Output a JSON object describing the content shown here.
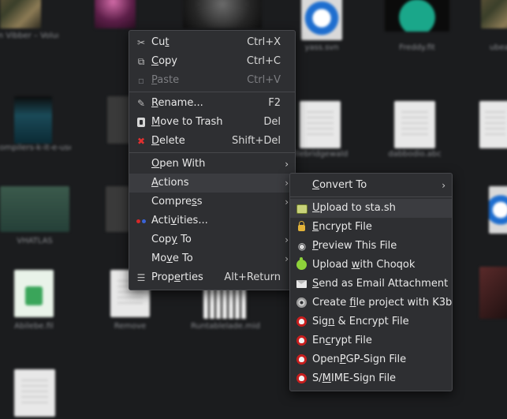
{
  "desktop": {
    "files": [
      {
        "label": "Brion Vibber – Volumic",
        "thumb": "photo1"
      },
      {
        "label": "",
        "thumb": "photo2"
      },
      {
        "label": "",
        "thumb": "photo3"
      },
      {
        "label": "yass.svn",
        "thumb": "globe"
      },
      {
        "label": "Freddy.fit",
        "thumb": "teal"
      },
      {
        "label": "ubeat...",
        "thumb": "photo1"
      },
      {
        "label": "compilers-k-it-e-user-manual.pdf",
        "thumb": "pdf"
      },
      {
        "label": "",
        "thumb": "dark"
      },
      {
        "label": "filebridgewald",
        "thumb": "doc"
      },
      {
        "label": "dabbodio.abc",
        "thumb": "doc"
      },
      {
        "label": "",
        "thumb": "doc"
      },
      {
        "label": "VHATLAS",
        "thumb": "sheet"
      },
      {
        "label": "",
        "thumb": "dark"
      },
      {
        "label": "",
        "thumb": "blue"
      },
      {
        "label": "Abilebe.fil",
        "thumb": "green"
      },
      {
        "label": "Remove",
        "thumb": "doc"
      },
      {
        "label": "Runtablelade.mid",
        "thumb": "keys"
      },
      {
        "label": "",
        "thumb": "red"
      },
      {
        "label": "",
        "thumb": "doc"
      }
    ]
  },
  "context_menu": {
    "items": [
      {
        "type": "item",
        "icon": "cut-icon",
        "glyph": "✂",
        "pre": "Cu",
        "mn": "t",
        "post": "",
        "shortcut": "Ctrl+X",
        "disabled": false,
        "submenu": false
      },
      {
        "type": "item",
        "icon": "copy-icon",
        "glyph": "⧉",
        "pre": "",
        "mn": "C",
        "post": "opy",
        "shortcut": "Ctrl+C",
        "disabled": false,
        "submenu": false
      },
      {
        "type": "item",
        "icon": "paste-icon",
        "glyph": "📋",
        "pre": "",
        "mn": "P",
        "post": "aste",
        "shortcut": "Ctrl+V",
        "disabled": true,
        "submenu": false
      },
      {
        "type": "separator"
      },
      {
        "type": "item",
        "icon": "rename-icon",
        "glyph": "✎",
        "pre": "",
        "mn": "R",
        "post": "ename...",
        "shortcut": "F2",
        "disabled": false,
        "submenu": false
      },
      {
        "type": "item",
        "icon": "trash-icon",
        "glyph": "",
        "pre": "",
        "mn": "M",
        "post": "ove to Trash",
        "shortcut": "Del",
        "disabled": false,
        "submenu": false
      },
      {
        "type": "item",
        "icon": "delete-icon",
        "glyph": "✖",
        "pre": "",
        "mn": "D",
        "post": "elete",
        "shortcut": "Shift+Del",
        "disabled": false,
        "submenu": false
      },
      {
        "type": "separator"
      },
      {
        "type": "item",
        "icon": "",
        "glyph": "",
        "pre": "",
        "mn": "O",
        "post": "pen With",
        "shortcut": "",
        "disabled": false,
        "submenu": true
      },
      {
        "type": "item",
        "icon": "",
        "glyph": "",
        "pre": "",
        "mn": "A",
        "post": "ctions",
        "shortcut": "",
        "disabled": false,
        "submenu": true,
        "highlighted": true
      },
      {
        "type": "item",
        "icon": "",
        "glyph": "",
        "pre": "Compre",
        "mn": "s",
        "post": "s",
        "shortcut": "",
        "disabled": false,
        "submenu": true
      },
      {
        "type": "item",
        "icon": "activities-icon",
        "glyph": "",
        "pre": "Acti",
        "mn": "v",
        "post": "ities...",
        "shortcut": "",
        "disabled": false,
        "submenu": false
      },
      {
        "type": "item",
        "icon": "",
        "glyph": "",
        "pre": "Cop",
        "mn": "y",
        "post": " To",
        "shortcut": "",
        "disabled": false,
        "submenu": true
      },
      {
        "type": "item",
        "icon": "",
        "glyph": "",
        "pre": "Mo",
        "mn": "v",
        "post": "e To",
        "shortcut": "",
        "disabled": false,
        "submenu": true
      },
      {
        "type": "item",
        "icon": "properties-icon",
        "glyph": "☰",
        "pre": "Prop",
        "mn": "e",
        "post": "rties",
        "shortcut": "Alt+Return",
        "disabled": false,
        "submenu": false
      }
    ]
  },
  "actions_submenu": {
    "items": [
      {
        "type": "item",
        "icon": "",
        "pre": "",
        "mn": "C",
        "post": "onvert To",
        "submenu": true
      },
      {
        "type": "separator"
      },
      {
        "type": "item",
        "icon": "upload-icon",
        "pre": "",
        "mn": "U",
        "post": "pload to sta.sh",
        "submenu": false,
        "highlighted": true
      },
      {
        "type": "item",
        "icon": "lock-icon",
        "pre": "",
        "mn": "E",
        "post": "ncrypt File",
        "submenu": false
      },
      {
        "type": "item",
        "icon": "eye-icon",
        "pre": "",
        "mn": "P",
        "post": "review This File",
        "submenu": false
      },
      {
        "type": "item",
        "icon": "choqok-icon",
        "pre": "Upload ",
        "mn": "w",
        "post": "ith Choqok",
        "submenu": false
      },
      {
        "type": "item",
        "icon": "mail-icon",
        "pre": "",
        "mn": "S",
        "post": "end as Email Attachment",
        "submenu": false
      },
      {
        "type": "item",
        "icon": "disc-icon",
        "pre": "Create ",
        "mn": "f",
        "post": "ile project with K3b",
        "submenu": false
      },
      {
        "type": "item",
        "icon": "gpg-icon",
        "pre": "Sig",
        "mn": "n",
        "post": " & Encrypt File",
        "submenu": false
      },
      {
        "type": "item",
        "icon": "gpg-icon",
        "pre": "En",
        "mn": "c",
        "post": "rypt File",
        "submenu": false
      },
      {
        "type": "item",
        "icon": "gpg-icon",
        "pre": "Open",
        "mn": "P",
        "post": "GP-Sign File",
        "submenu": false
      },
      {
        "type": "item",
        "icon": "gpg-icon",
        "pre": "S/",
        "mn": "M",
        "post": "IME-Sign File",
        "submenu": false
      }
    ]
  }
}
